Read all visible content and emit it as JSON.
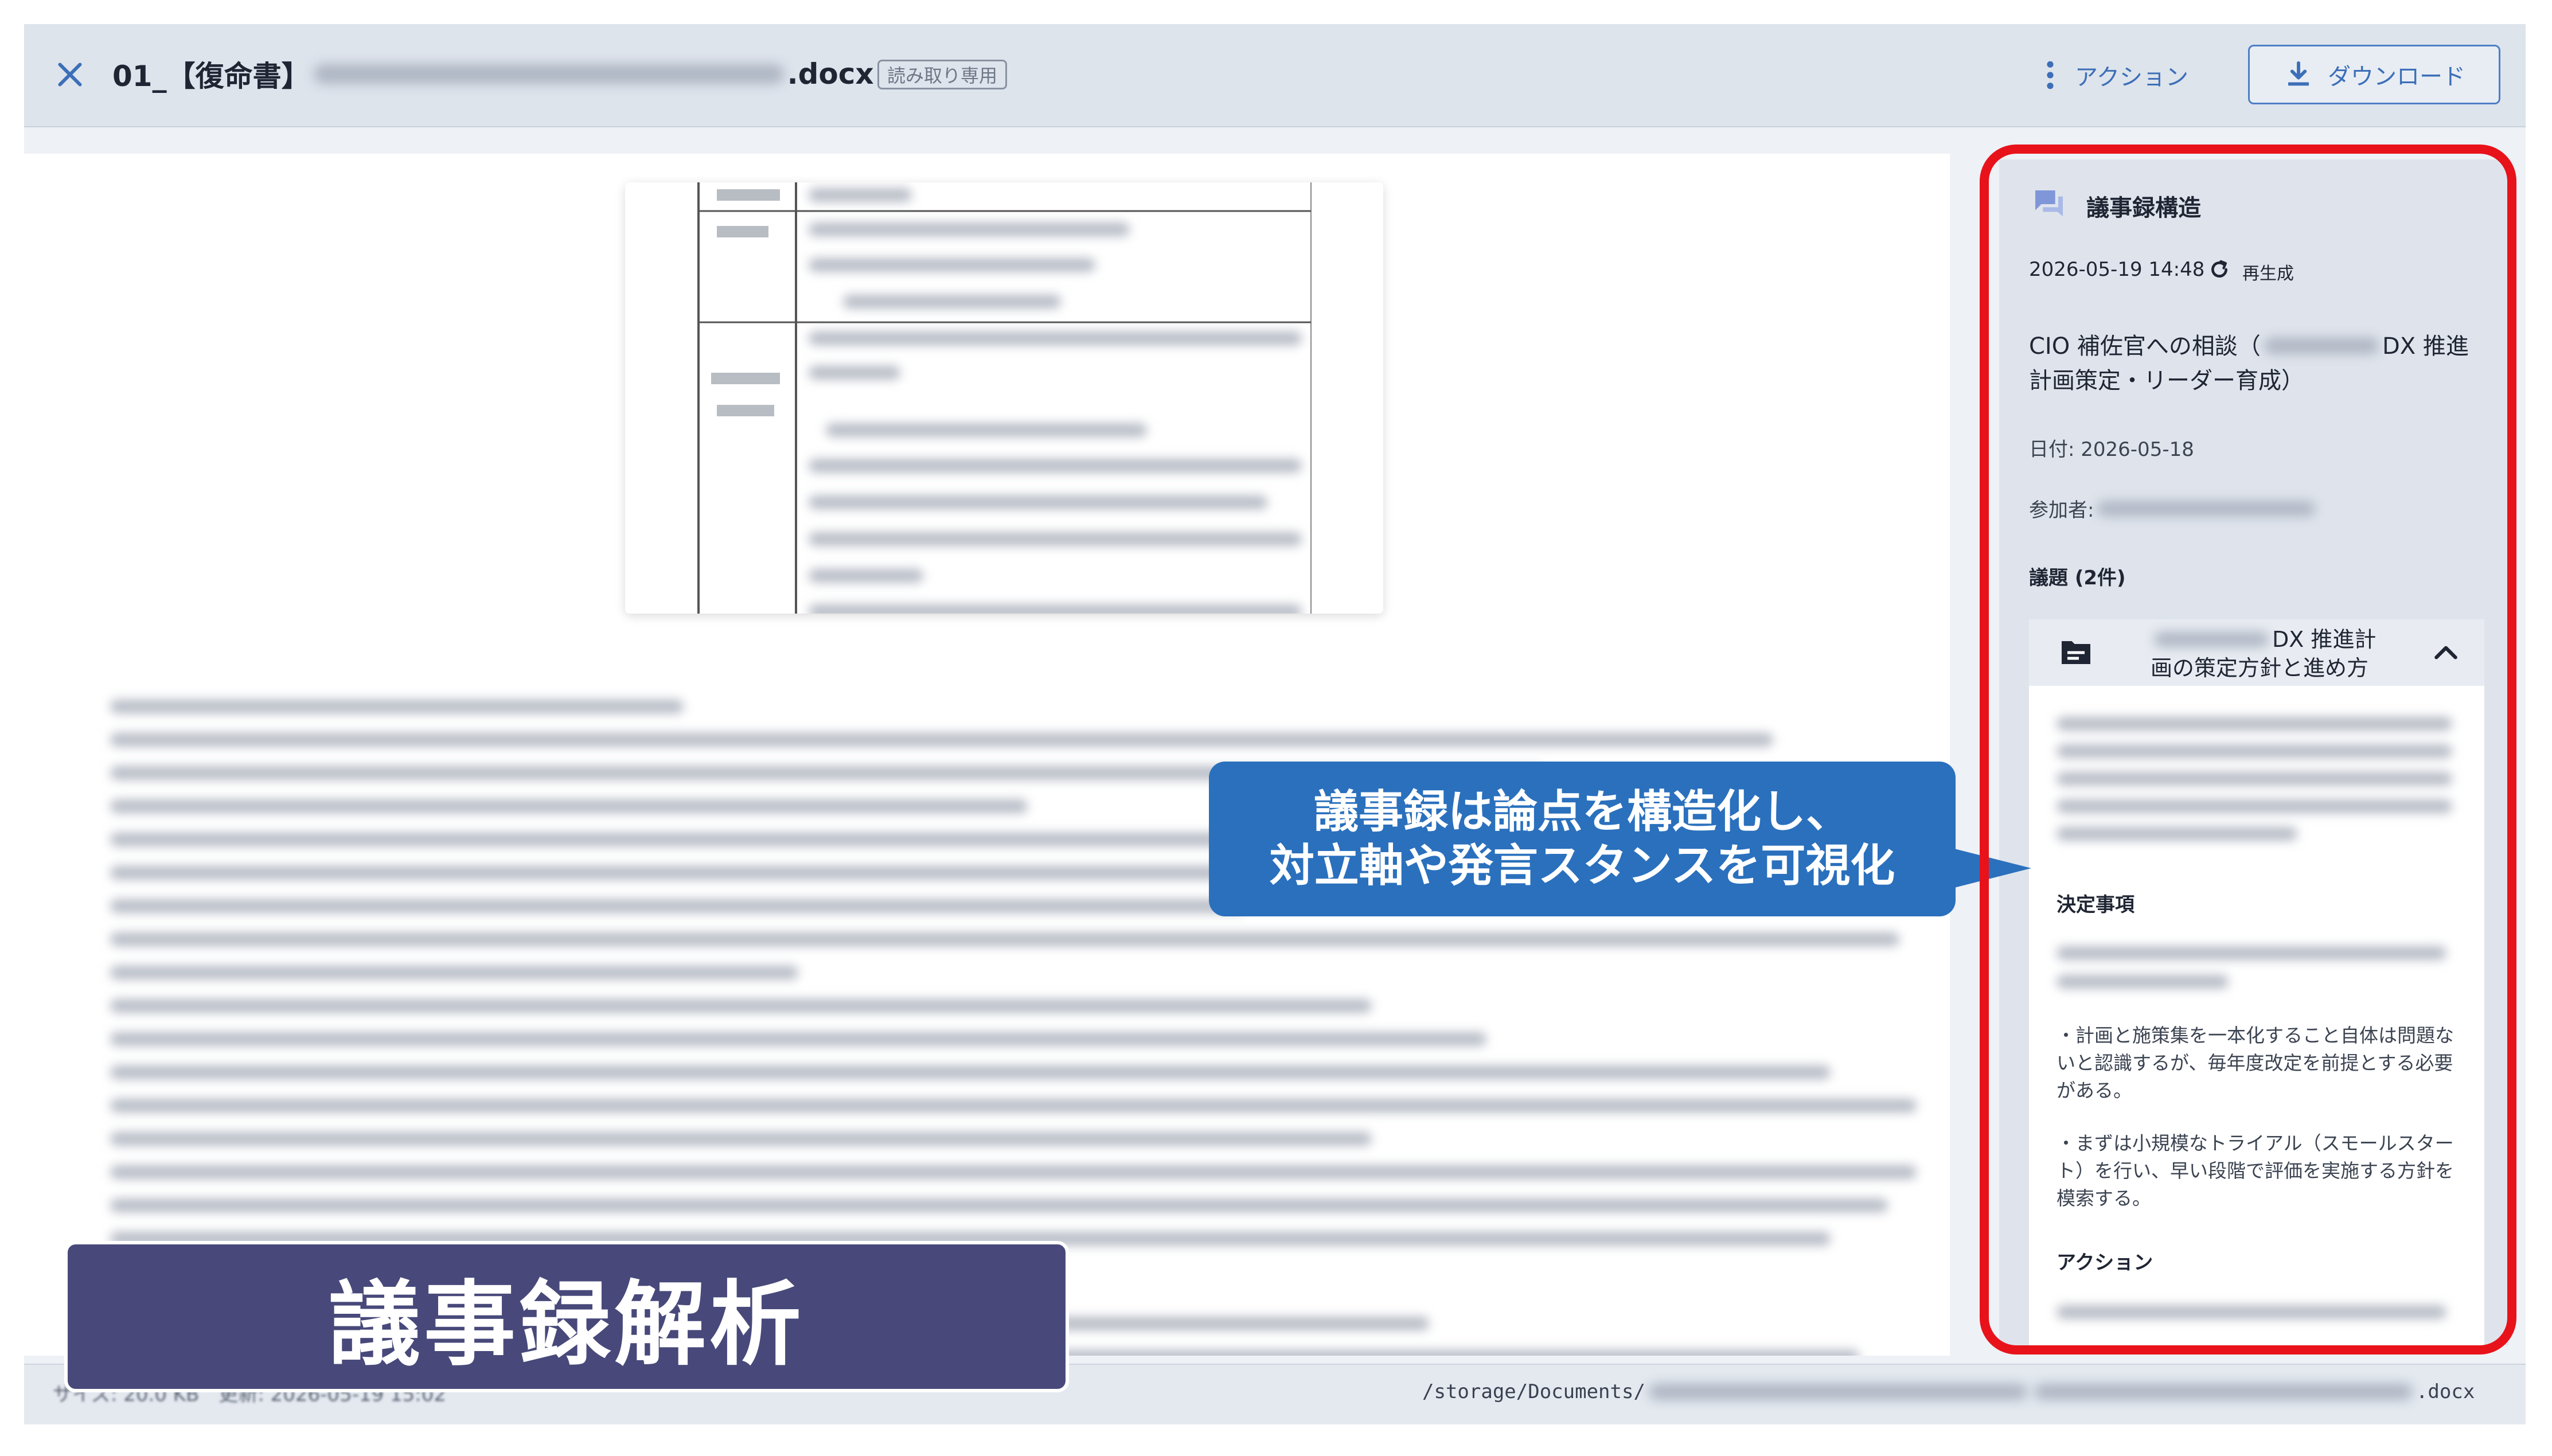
{
  "header": {
    "title_prefix": "01_【復命書】",
    "title_suffix": ".docx",
    "readonly_badge": "読み取り専用",
    "action_label": "アクション",
    "download_label": "ダウンロード"
  },
  "status_bar": {
    "left_text": "サイズ: 20.0 KB　更新: 2026-05-19 15:02",
    "path_prefix": "/storage/Documents/",
    "path_suffix": ".docx"
  },
  "panel": {
    "title": "議事録構造",
    "generated_at": "2026-05-19 14:48",
    "regenerate_label": "再生成",
    "meeting_title_prefix": "CIO 補佐官への相談（",
    "meeting_title_suffix": "DX 推進計画策定・リーダー育成）",
    "date_line": "日付: 2026-05-18",
    "attendees_label": "参加者:",
    "topics_heading": "議題 (2件)",
    "topic": {
      "title_line1": "DX 推進計",
      "title_line2": "画の策定方針と進め方"
    },
    "decisions_label": "決定事項",
    "decision_items": [
      "・計画と施策集を一本化すること自体は問題ないと認識するが、毎年度改定を前提とする必要がある。",
      "・まずは小規模なトライアル（スモールスタート）を行い、早い段階で評価を実施する方針を模索する。"
    ],
    "actions_label": "アクション"
  },
  "annotations": {
    "callout_line1": "議事録は論点を構造化し、",
    "callout_line2": "対立軸や発言スタンスを可視化",
    "banner": "議事録解析"
  },
  "colors": {
    "accent_blue": "#2a70bd",
    "highlight_red": "#e8121b",
    "banner_navy": "#48497a",
    "link_blue": "#3d6fb8"
  }
}
